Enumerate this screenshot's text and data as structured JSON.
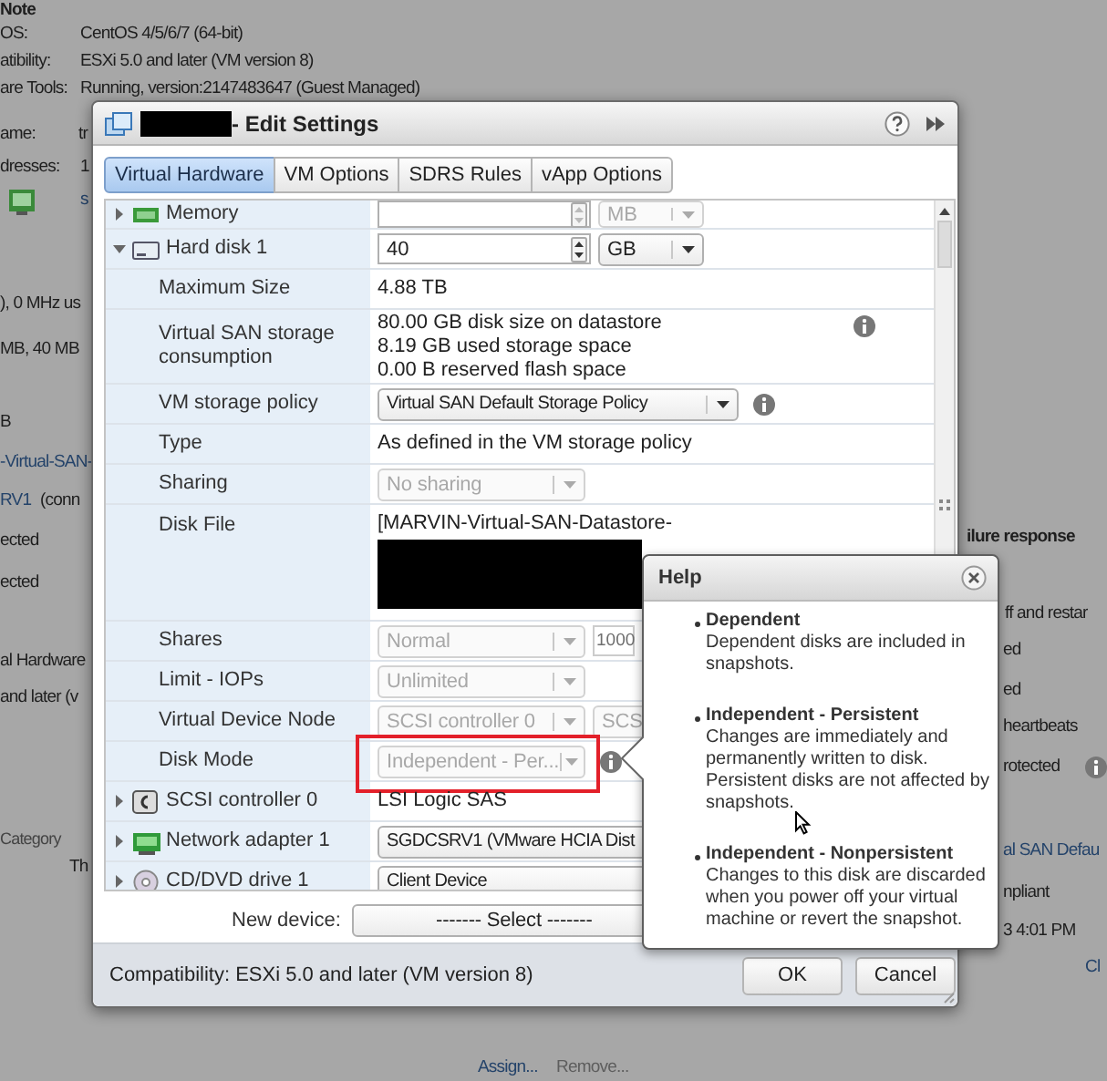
{
  "background": [
    {
      "kind": "bold",
      "text": "Note"
    },
    {
      "kind": "text",
      "text": "OS:"
    },
    {
      "kind": "text",
      "text": "CentOS 4/5/6/7 (64-bit)"
    },
    {
      "kind": "text",
      "text": "atibility:"
    },
    {
      "kind": "text",
      "text": "ESXi 5.0 and later (VM version 8)"
    },
    {
      "kind": "text",
      "text": "are Tools:"
    },
    {
      "kind": "text",
      "text": "Running, version:2147483647 (Guest Managed)"
    },
    {
      "kind": "text",
      "text": "ame:"
    },
    {
      "kind": "text",
      "text": "tr"
    },
    {
      "kind": "text",
      "text": "dresses:"
    },
    {
      "kind": "text",
      "text": "1"
    },
    {
      "kind": "link",
      "text": "s"
    },
    {
      "kind": "icon"
    },
    {
      "kind": "text",
      "text": "), 0 MHz us"
    },
    {
      "kind": "text",
      "text": "MB, 40 MB"
    },
    {
      "kind": "text",
      "text": "B"
    },
    {
      "kind": "link",
      "text": "-Virtual-SAN-"
    },
    {
      "kind": "link",
      "text": "RV1"
    },
    {
      "kind": "text",
      "text": "(conn"
    },
    {
      "kind": "text",
      "text": "ected"
    },
    {
      "kind": "text",
      "text": "ected"
    },
    {
      "kind": "text",
      "text": "al Hardware"
    },
    {
      "kind": "text",
      "text": "and later (v"
    },
    {
      "kind": "small",
      "text": "Category"
    },
    {
      "kind": "text",
      "text": "Th"
    },
    {
      "kind": "link",
      "text": "Assign..."
    },
    {
      "kind": "muted",
      "text": "Remove..."
    },
    {
      "kind": "bold",
      "text": "ilure response"
    },
    {
      "kind": "text",
      "text": "ff and restar"
    },
    {
      "kind": "text",
      "text": "ed"
    },
    {
      "kind": "text",
      "text": "ed"
    },
    {
      "kind": "text",
      "text": "heartbeats"
    },
    {
      "kind": "text",
      "text": "rotected"
    },
    {
      "kind": "info"
    },
    {
      "kind": "link",
      "text": "al SAN Defau"
    },
    {
      "kind": "text",
      "text": "npliant"
    },
    {
      "kind": "text",
      "text": "3 4:01 PM"
    },
    {
      "kind": "link",
      "text": "Cl"
    }
  ],
  "dialog": {
    "title": "- Edit Settings",
    "tabs": [
      {
        "label": "Virtual Hardware",
        "selected": true
      },
      {
        "label": "VM Options",
        "selected": false
      },
      {
        "label": "SDRS Rules",
        "selected": false
      },
      {
        "label": "vApp Options",
        "selected": false
      }
    ],
    "hardware": [
      {
        "kind": "memory",
        "label": "Memory",
        "expanded": false,
        "controls": [
          {
            "kind": "spinner",
            "disabled": true
          },
          {
            "kind": "unit",
            "value": "MB",
            "disabled": true
          }
        ]
      },
      {
        "kind": "disk",
        "label": "Hard disk 1",
        "expanded": true,
        "controls": [
          {
            "kind": "spinner",
            "value": "40",
            "disabled": false
          },
          {
            "kind": "unit",
            "value": "GB",
            "disabled": false
          }
        ],
        "children": [
          {
            "label": "Maximum Size",
            "controls": [
              {
                "kind": "text",
                "value": "4.88 TB"
              }
            ]
          },
          {
            "label": "Virtual SAN storage consumption",
            "info": true,
            "controls": [
              {
                "kind": "lines",
                "lines": [
                  "80.00 GB disk size on datastore",
                  "8.19 GB used storage space",
                  "0.00 B reserved flash space"
                ]
              }
            ]
          },
          {
            "label": "VM storage policy",
            "info": true,
            "controls": [
              {
                "kind": "dropdown",
                "value": "Virtual SAN Default Storage Policy",
                "disabled": false
              }
            ]
          },
          {
            "label": "Type",
            "controls": [
              {
                "kind": "text",
                "value": "As defined in the VM storage policy"
              }
            ]
          },
          {
            "label": "Sharing",
            "controls": [
              {
                "kind": "dropdown",
                "value": "No sharing",
                "disabled": true
              }
            ]
          },
          {
            "label": "Disk File",
            "controls": [
              {
                "kind": "path",
                "value": "[MARVIN-Virtual-SAN-Datastore-"
              }
            ]
          },
          {
            "label": "Shares",
            "controls": [
              {
                "kind": "dropdown",
                "value": "Normal",
                "disabled": true
              },
              {
                "kind": "number",
                "value": "1000",
                "disabled": true
              }
            ]
          },
          {
            "label": "Limit - IOPs",
            "controls": [
              {
                "kind": "dropdown",
                "value": "Unlimited",
                "disabled": true
              }
            ]
          },
          {
            "label": "Virtual Device Node",
            "controls": [
              {
                "kind": "dropdown",
                "value": "SCSI controller 0",
                "disabled": true
              },
              {
                "kind": "dropdown",
                "value": "SCS",
                "disabled": true
              }
            ]
          },
          {
            "label": "Disk Mode",
            "info": true,
            "highlighted": true,
            "controls": [
              {
                "kind": "dropdown",
                "value": "Independent - Per...",
                "disabled": true
              }
            ]
          }
        ]
      },
      {
        "kind": "controller",
        "label": "SCSI controller 0",
        "expanded": false,
        "controls": [
          {
            "kind": "text",
            "value": "LSI Logic SAS"
          }
        ]
      },
      {
        "kind": "network",
        "label": "Network adapter 1",
        "expanded": false,
        "controls": [
          {
            "kind": "dropdown",
            "value": "SGDCSRV1 (VMware HCIA Dist",
            "disabled": false
          }
        ]
      },
      {
        "kind": "disc",
        "label": "CD/DVD drive 1",
        "expanded": false,
        "controls": [
          {
            "kind": "dropdown",
            "value": "Client Device",
            "disabled": false
          }
        ]
      }
    ],
    "new_device": {
      "label": "New device:",
      "value": "------- Select -------"
    },
    "compatibility": "Compatibility: ESXi 5.0 and later (VM version 8)",
    "buttons": [
      "OK",
      "Cancel"
    ]
  },
  "help": {
    "title": "Help",
    "items": [
      {
        "title": "Dependent",
        "text": "Dependent disks are included in snapshots."
      },
      {
        "title": "Independent - Persistent",
        "text": "Changes are immediately and permanently written to disk. Persistent disks are not affected by snapshots."
      },
      {
        "title": "Independent - Nonpersistent",
        "text": "Changes to this disk are discarded when you power off your virtual machine or revert the snapshot."
      }
    ]
  }
}
